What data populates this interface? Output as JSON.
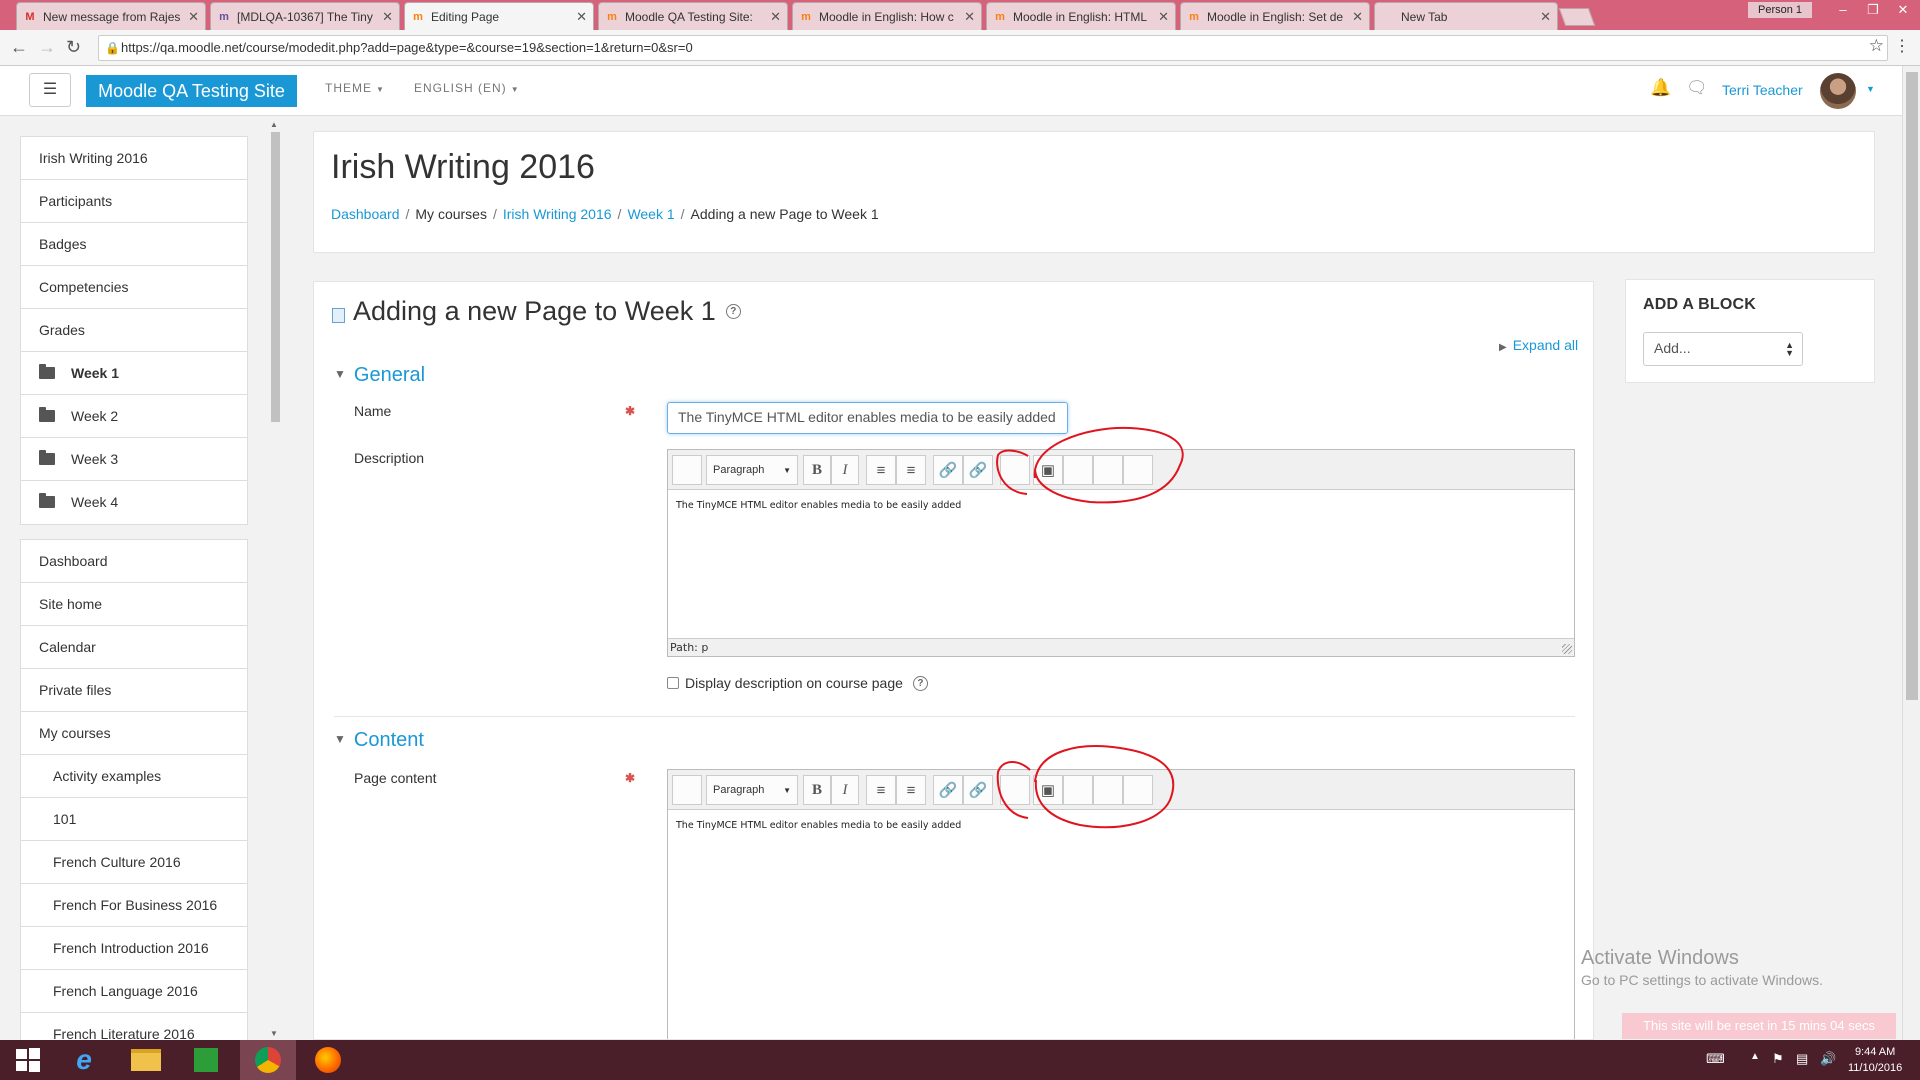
{
  "browser": {
    "tabs": [
      {
        "label": "New message from Rajes",
        "favicon": "M",
        "favicon_color": "#d93025"
      },
      {
        "label": "[MDLQA-10367] The Tiny",
        "favicon": "m",
        "favicon_color": "#6b4ea3"
      },
      {
        "label": "Editing Page",
        "favicon": "m",
        "favicon_color": "#f98012"
      },
      {
        "label": "Moodle QA Testing Site:",
        "favicon": "m",
        "favicon_color": "#f98012"
      },
      {
        "label": "Moodle in English: How c",
        "favicon": "m",
        "favicon_color": "#f98012"
      },
      {
        "label": "Moodle in English: HTML",
        "favicon": "m",
        "favicon_color": "#f98012"
      },
      {
        "label": "Moodle in English: Set de",
        "favicon": "m",
        "favicon_color": "#f98012"
      },
      {
        "label": "New Tab",
        "favicon": "",
        "favicon_color": "#888"
      }
    ],
    "profile": "Person 1",
    "url": "https://qa.moodle.net/course/modedit.php?add=page&type=&course=19&section=1&return=0&sr=0"
  },
  "navbar": {
    "site_name": "Moodle QA Testing Site",
    "theme_label": "THEME",
    "language_label": "ENGLISH (EN)",
    "user_name": "Terri Teacher",
    "brand_color": "#1a98d5"
  },
  "sidebar": {
    "course_block": [
      {
        "label": "Irish Writing 2016",
        "folder": false,
        "bold": false
      },
      {
        "label": "Participants",
        "folder": false,
        "bold": false
      },
      {
        "label": "Badges",
        "folder": false,
        "bold": false
      },
      {
        "label": "Competencies",
        "folder": false,
        "bold": false
      },
      {
        "label": "Grades",
        "folder": false,
        "bold": false
      },
      {
        "label": "Week 1",
        "folder": true,
        "bold": true
      },
      {
        "label": "Week 2",
        "folder": true,
        "bold": false
      },
      {
        "label": "Week 3",
        "folder": true,
        "bold": false
      },
      {
        "label": "Week 4",
        "folder": true,
        "bold": false
      }
    ],
    "site_block": [
      {
        "label": "Dashboard",
        "indent": false
      },
      {
        "label": "Site home",
        "indent": false
      },
      {
        "label": "Calendar",
        "indent": false
      },
      {
        "label": "Private files",
        "indent": false
      },
      {
        "label": "My courses",
        "indent": false
      },
      {
        "label": "Activity examples",
        "indent": true
      },
      {
        "label": "101",
        "indent": true
      },
      {
        "label": "French Culture 2016",
        "indent": true
      },
      {
        "label": "French For Business 2016",
        "indent": true
      },
      {
        "label": "French Introduction 2016",
        "indent": true
      },
      {
        "label": "French Language 2016",
        "indent": true
      },
      {
        "label": "French Literature 2016",
        "indent": true
      }
    ]
  },
  "header": {
    "course_title": "Irish Writing 2016",
    "breadcrumb": {
      "dashboard": "Dashboard",
      "my_courses": "My courses",
      "course": "Irish Writing 2016",
      "week": "Week 1",
      "current": "Adding a new Page to Week 1",
      "sep": "/"
    }
  },
  "form": {
    "title": "Adding a new Page to Week 1",
    "expand_all": "Expand all",
    "general_label": "General",
    "name_label": "Name",
    "name_value": "The TinyMCE HTML editor enables media to be easily added",
    "description_label": "Description",
    "editor_format": "Paragraph",
    "description_text": "The TinyMCE HTML editor enables media to be easily added",
    "path_text": "Path: p",
    "display_desc_label": "Display description on course page",
    "content_label": "Content",
    "page_content_label": "Page content",
    "page_content_text": "The TinyMCE HTML editor enables media to be easily added"
  },
  "add_block": {
    "title": "ADD A BLOCK",
    "select_value": "Add..."
  },
  "overlay": {
    "activate_title": "Activate Windows",
    "activate_sub": "Go to PC settings to activate Windows.",
    "reset_notice": "This site will be reset in 15 mins 04 secs"
  },
  "taskbar": {
    "time": "9:44 AM",
    "date": "11/10/2016"
  },
  "annotation_color": "#e0141e"
}
